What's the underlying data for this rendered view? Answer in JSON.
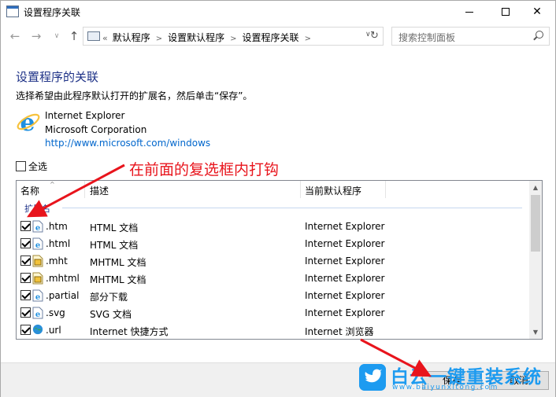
{
  "window": {
    "title": "设置程序关联",
    "controls": {
      "minimize": "—",
      "maximize": "☐",
      "close": "✕"
    }
  },
  "nav": {
    "back_icon": "arrow-left-icon",
    "forward_icon": "arrow-right-icon",
    "up_icon": "arrow-up-icon",
    "breadcrumb_prefix": "«",
    "breadcrumbs": [
      "默认程序",
      "设置默认程序",
      "设置程序关联"
    ],
    "refresh_glyph": "↻",
    "search_placeholder": "搜索控制面板"
  },
  "main": {
    "heading": "设置程序的关联",
    "description": "选择希望由此程序默认打开的扩展名，然后单击“保存”。",
    "program": {
      "name": "Internet Explorer",
      "company": "Microsoft Corporation",
      "url": "http://www.microsoft.com/windows"
    },
    "select_all_label": "全选",
    "select_all_checked": false
  },
  "annotation": {
    "text": "在前面的复选框内打钩",
    "color": "#e8141c"
  },
  "list": {
    "columns": [
      "名称",
      "描述",
      "当前默认程序"
    ],
    "group_label": "扩展名",
    "rows": [
      {
        "ext": ".htm",
        "desc": "HTML 文档",
        "program": "Internet Explorer",
        "icon": "ie-file-icon",
        "checked": true
      },
      {
        "ext": ".html",
        "desc": "HTML 文档",
        "program": "Internet Explorer",
        "icon": "ie-file-icon",
        "checked": true
      },
      {
        "ext": ".mht",
        "desc": "MHTML 文档",
        "program": "Internet Explorer",
        "icon": "mhtml-file-icon",
        "checked": true
      },
      {
        "ext": ".mhtml",
        "desc": "MHTML 文档",
        "program": "Internet Explorer",
        "icon": "mhtml-file-icon",
        "checked": true
      },
      {
        "ext": ".partial",
        "desc": "部分下载",
        "program": "Internet Explorer",
        "icon": "ie-file-icon",
        "checked": true
      },
      {
        "ext": ".svg",
        "desc": "SVG 文档",
        "program": "Internet Explorer",
        "icon": "ie-file-icon",
        "checked": true
      },
      {
        "ext": ".url",
        "desc": "Internet 快捷方式",
        "program": "Internet 浏览器",
        "icon": "globe-icon",
        "checked": true
      }
    ]
  },
  "footer": {
    "save_label": "保存",
    "cancel_label": "取消"
  },
  "watermark": {
    "title": "白云一键重装系统",
    "url": "www.baiyunxitong.com"
  }
}
